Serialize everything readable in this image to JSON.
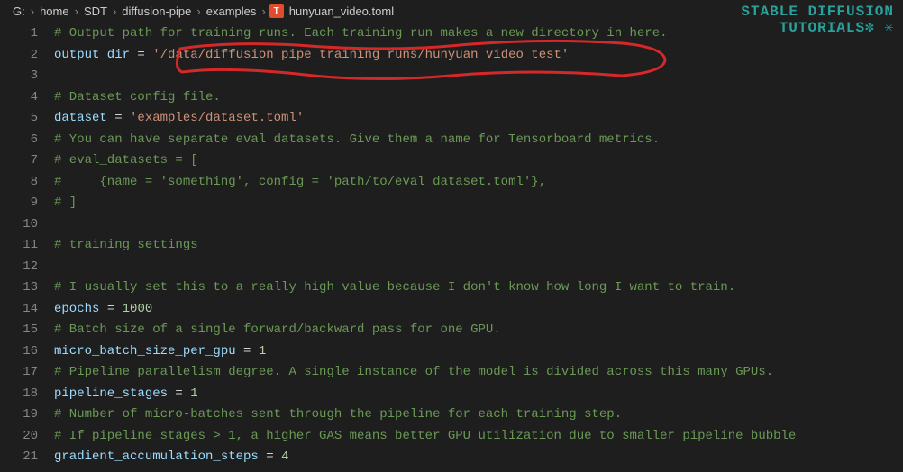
{
  "breadcrumbs": [
    "G:",
    "home",
    "SDT",
    "diffusion-pipe",
    "examples"
  ],
  "file_icon_label": "T",
  "filename": "hunyuan_video.toml",
  "code_lines": [
    {
      "n": 1,
      "tokens": [
        {
          "cls": "c-comment",
          "t": "# Output path for training runs. Each training run makes a new directory in here."
        }
      ]
    },
    {
      "n": 2,
      "tokens": [
        {
          "cls": "c-key",
          "t": "output_dir"
        },
        {
          "cls": "c-eq",
          "t": " = "
        },
        {
          "cls": "c-string",
          "t": "'/data/diffusion_pipe_training_runs/hunyuan_video_test'"
        }
      ]
    },
    {
      "n": 3,
      "tokens": []
    },
    {
      "n": 4,
      "tokens": [
        {
          "cls": "c-comment",
          "t": "# Dataset config file."
        }
      ]
    },
    {
      "n": 5,
      "tokens": [
        {
          "cls": "c-key",
          "t": "dataset"
        },
        {
          "cls": "c-eq",
          "t": " = "
        },
        {
          "cls": "c-string",
          "t": "'examples/dataset.toml'"
        }
      ]
    },
    {
      "n": 6,
      "tokens": [
        {
          "cls": "c-comment",
          "t": "# You can have separate eval datasets. Give them a name for Tensorboard metrics."
        }
      ]
    },
    {
      "n": 7,
      "tokens": [
        {
          "cls": "c-comment",
          "t": "# eval_datasets = ["
        }
      ]
    },
    {
      "n": 8,
      "tokens": [
        {
          "cls": "c-comment",
          "t": "#     {name = 'something', config = 'path/to/eval_dataset.toml'},"
        }
      ]
    },
    {
      "n": 9,
      "tokens": [
        {
          "cls": "c-comment",
          "t": "# ]"
        }
      ]
    },
    {
      "n": 10,
      "tokens": []
    },
    {
      "n": 11,
      "tokens": [
        {
          "cls": "c-comment",
          "t": "# training settings"
        }
      ]
    },
    {
      "n": 12,
      "tokens": []
    },
    {
      "n": 13,
      "tokens": [
        {
          "cls": "c-comment",
          "t": "# I usually set this to a really high value because I don't know how long I want to train."
        }
      ]
    },
    {
      "n": 14,
      "tokens": [
        {
          "cls": "c-key",
          "t": "epochs"
        },
        {
          "cls": "c-eq",
          "t": " = "
        },
        {
          "cls": "c-num",
          "t": "1000"
        }
      ]
    },
    {
      "n": 15,
      "tokens": [
        {
          "cls": "c-comment",
          "t": "# Batch size of a single forward/backward pass for one GPU."
        }
      ]
    },
    {
      "n": 16,
      "tokens": [
        {
          "cls": "c-key",
          "t": "micro_batch_size_per_gpu"
        },
        {
          "cls": "c-eq",
          "t": " = "
        },
        {
          "cls": "c-num",
          "t": "1"
        }
      ]
    },
    {
      "n": 17,
      "tokens": [
        {
          "cls": "c-comment",
          "t": "# Pipeline parallelism degree. A single instance of the model is divided across this many GPUs."
        }
      ]
    },
    {
      "n": 18,
      "tokens": [
        {
          "cls": "c-key",
          "t": "pipeline_stages"
        },
        {
          "cls": "c-eq",
          "t": " = "
        },
        {
          "cls": "c-num",
          "t": "1"
        }
      ]
    },
    {
      "n": 19,
      "tokens": [
        {
          "cls": "c-comment",
          "t": "# Number of micro-batches sent through the pipeline for each training step."
        }
      ]
    },
    {
      "n": 20,
      "tokens": [
        {
          "cls": "c-comment",
          "t": "# If pipeline_stages > 1, a higher GAS means better GPU utilization due to smaller pipeline bubble"
        }
      ]
    },
    {
      "n": 21,
      "tokens": [
        {
          "cls": "c-key",
          "t": "gradient_accumulation_steps"
        },
        {
          "cls": "c-eq",
          "t": " = "
        },
        {
          "cls": "c-num",
          "t": "4"
        }
      ]
    }
  ],
  "watermark": {
    "line1": "STABLE DIFFUSION",
    "line2": "TUTORIALS"
  }
}
